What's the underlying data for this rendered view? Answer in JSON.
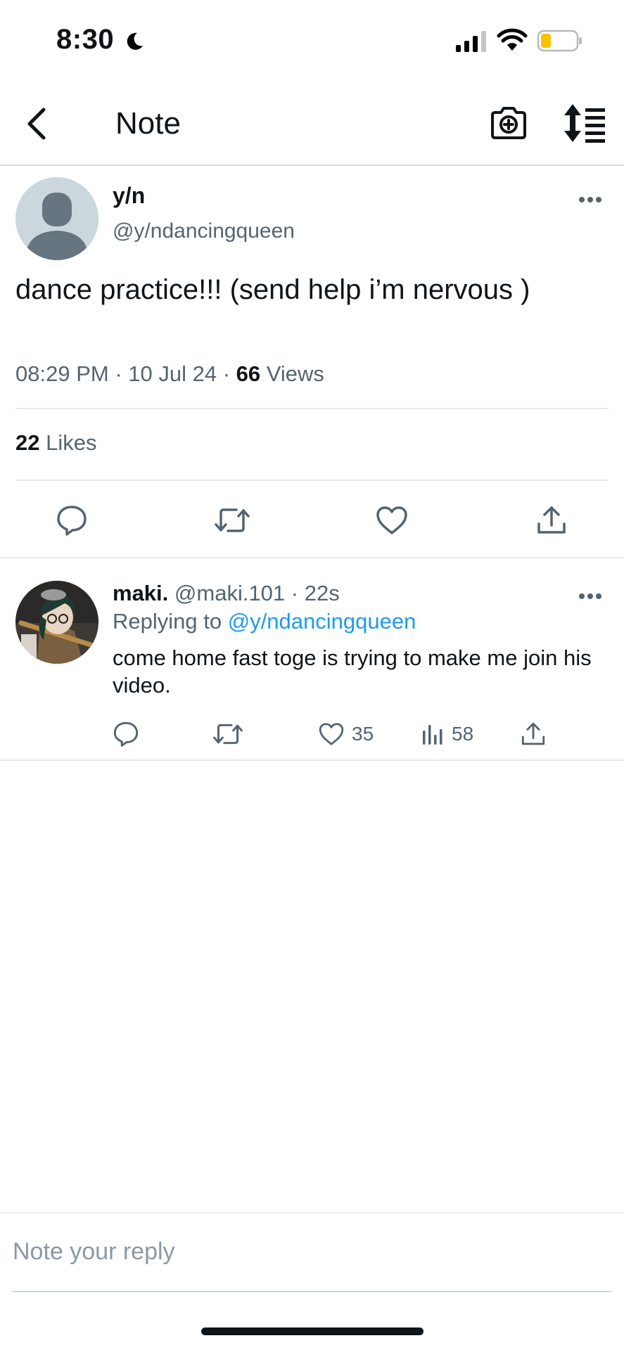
{
  "status_bar": {
    "time": "8:30",
    "icons": [
      "moon-icon",
      "signal-icon",
      "wifi-icon",
      "battery-icon"
    ],
    "battery_color": "#f7c500"
  },
  "nav": {
    "title": "Note",
    "icons": [
      "back-chevron-icon",
      "camera-plus-icon",
      "sort-lines-icon"
    ]
  },
  "main_tweet": {
    "author_name": "y/n",
    "author_handle": "@y/ndancingqueen",
    "text": "dance practice!!! (send help i’m nervous )",
    "time": "08:29 PM",
    "date": "10 Jul 24",
    "views_count": "66",
    "views_label": "Views",
    "likes_count": "22",
    "likes_label": "Likes",
    "action_icons": [
      "reply-icon",
      "retweet-icon",
      "like-icon",
      "share-icon"
    ]
  },
  "reply": {
    "author_name": "maki.",
    "author_handle": "@maki.101",
    "age": "22s",
    "replying_label": "Replying to",
    "replying_to": "@y/ndancingqueen",
    "text": "come home fast toge is trying to make me join his video.",
    "likes": "35",
    "views": "58",
    "action_icons": [
      "reply-icon",
      "retweet-icon",
      "like-icon",
      "views-chart-icon",
      "share-icon"
    ]
  },
  "composer": {
    "placeholder": "Note your reply"
  },
  "colors": {
    "link": "#1d9bf0",
    "muted": "#536471",
    "text": "#0f1419"
  }
}
